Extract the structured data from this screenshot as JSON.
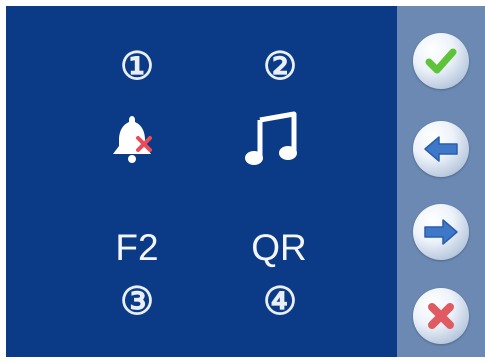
{
  "options": [
    {
      "number": "①",
      "icon": "bell-muted-icon"
    },
    {
      "number": "②",
      "icon": "music-note-icon"
    },
    {
      "number": "③",
      "label": "F2"
    },
    {
      "number": "④",
      "label": "QR"
    }
  ],
  "side_buttons": [
    {
      "icon": "check-icon"
    },
    {
      "icon": "arrow-left-icon"
    },
    {
      "icon": "arrow-right-icon"
    },
    {
      "icon": "close-icon"
    }
  ],
  "colors": {
    "panel": "#0b3b86",
    "sidebar": "#6b89b2",
    "check": "#5fc33a",
    "arrow": "#3f78c8",
    "close": "#e05a62"
  }
}
